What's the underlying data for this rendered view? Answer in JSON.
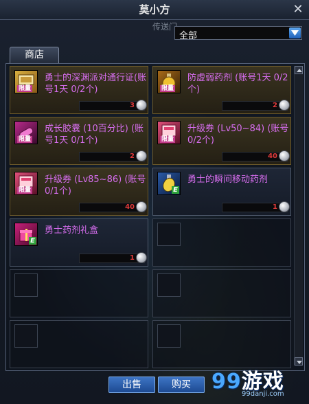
{
  "window": {
    "title": "莫小方",
    "npc_label": "传送门"
  },
  "filter": {
    "selected": "全部"
  },
  "tab": {
    "label": "商店"
  },
  "items": [
    {
      "name": "勇士的深渊派对通行证(账号1天 0/2个)",
      "price": "3",
      "tag": "限量",
      "style": "gold"
    },
    {
      "name": "防虚弱药剂 (账号1天 0/2个)",
      "price": "2",
      "tag": "限量",
      "style": "gold"
    },
    {
      "name": "成长胶囊 (10百分比) (账号1天 0/1个)",
      "price": "2",
      "tag": "限量",
      "style": "gold"
    },
    {
      "name": "升级券 (Lv50~84) (账号 0/2个)",
      "price": "40",
      "tag": "限量",
      "style": "gold"
    },
    {
      "name": "升级券 (Lv85~86) (账号 0/1个)",
      "price": "40",
      "tag": "限量",
      "style": "gold"
    },
    {
      "name": "勇士的瞬间移动药剂",
      "price": "1",
      "tag": "E",
      "style": "plain"
    },
    {
      "name": "勇士药剂礼盒",
      "price": "1",
      "tag": "E",
      "style": "plain"
    }
  ],
  "buttons": {
    "sell": "出售",
    "buy": "购买"
  },
  "watermark": {
    "digits": "99",
    "text": "游戏",
    "url": "99danji.com"
  },
  "colors": {
    "accent": "#2b62b0",
    "item_name": "#d86ef0",
    "price": "#e03a3a"
  }
}
